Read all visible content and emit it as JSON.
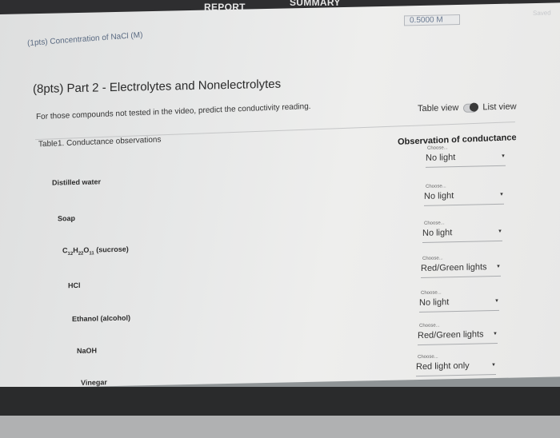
{
  "tabs": {
    "report": "REPORT",
    "summary": "SUMMARY"
  },
  "previous_row": {
    "label_fragment": "(1pts) Concentration of NaCl (M)",
    "value_fragment": "0.5000 M"
  },
  "saved_label": "Saved",
  "heading": "(8pts) Part 2 - Electrolytes and Nonelectrolytes",
  "instructions": "For those compounds not tested in the video, predict the conductivity reading.",
  "view_toggle": {
    "table_view": "Table view",
    "list_view": "List view"
  },
  "table": {
    "caption": "Table1. Conductance observations",
    "column_header": "Observation of conductance",
    "choose_placeholder": "Choose...",
    "rows": [
      {
        "label": "Distilled water",
        "value": "No light"
      },
      {
        "label": "Soap",
        "value": "No light"
      },
      {
        "label_parts": [
          "C",
          "12",
          "H",
          "22",
          "O",
          "11",
          " (sucrose)"
        ],
        "value": "No light"
      },
      {
        "label": "HCl",
        "value": "Red/Green lights"
      },
      {
        "label": "Ethanol (alcohol)",
        "value": "No light"
      },
      {
        "label": "NaOH",
        "value": "Red/Green lights"
      },
      {
        "label": "Vinegar",
        "value": "Red light only"
      }
    ]
  }
}
